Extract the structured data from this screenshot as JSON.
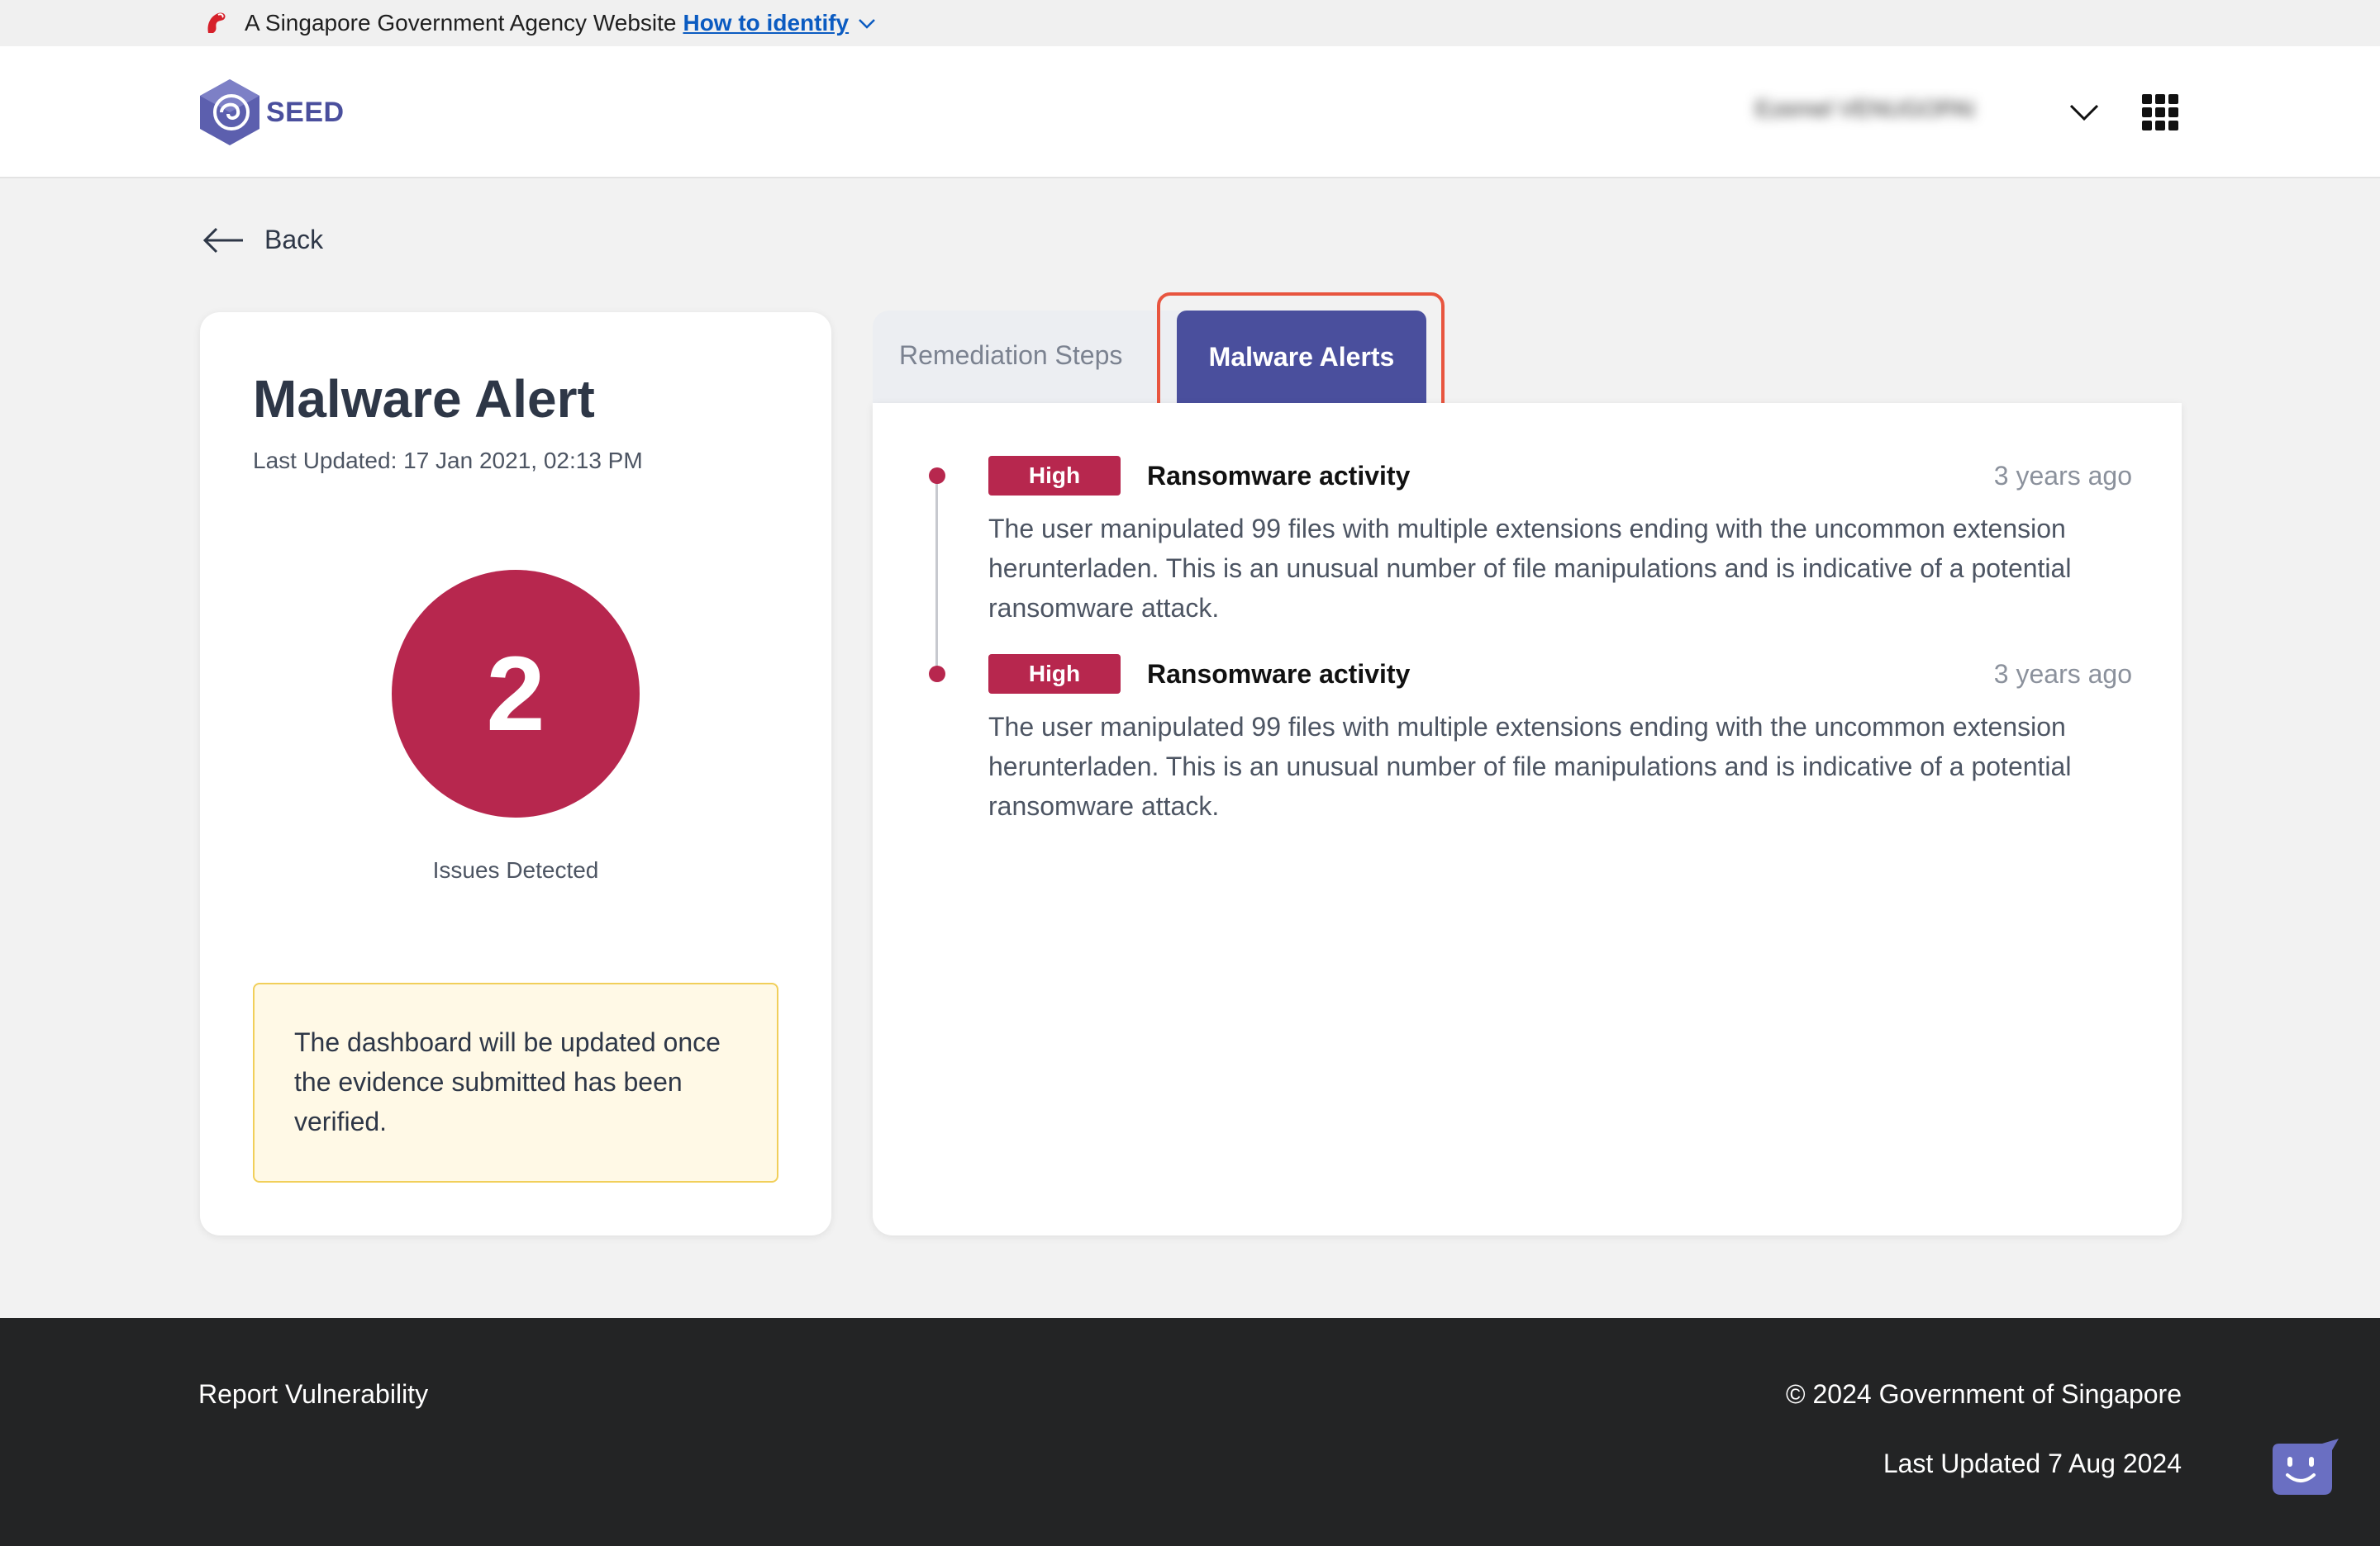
{
  "masthead": {
    "text": "A Singapore Government Agency Website",
    "link": "How to identify"
  },
  "header": {
    "logo_text": "SEED",
    "user_name": "Ezemel VENUGOPALAN",
    "icons": {
      "logo": "seed-logo-icon",
      "user_menu": "chevron-down-icon",
      "apps": "apps-grid-icon"
    }
  },
  "back": {
    "label": "Back"
  },
  "summary": {
    "title": "Malware Alert",
    "last_updated": "Last Updated: 17 Jan 2021, 02:13 PM",
    "issue_count": "2",
    "issue_label": "Issues Detected",
    "note": "The dashboard will be updated once the evidence submitted has been verified."
  },
  "tabs": {
    "remediation": "Remediation Steps",
    "malware": "Malware Alerts",
    "active": "malware"
  },
  "alerts": [
    {
      "severity": "High",
      "title": "Ransomware activity",
      "time": "3 years ago",
      "description": "The user manipulated 99 files with multiple extensions ending with the uncommon extension herunterladen. This is an unusual number of file manipulations and is indicative of a potential ransomware attack."
    },
    {
      "severity": "High",
      "title": "Ransomware activity",
      "time": "3 years ago",
      "description": "The user manipulated 99 files with multiple extensions ending with the uncommon extension herunterladen. This is an unusual number of file manipulations and is indicative of a potential ransomware attack."
    }
  ],
  "footer": {
    "report": "Report Vulnerability",
    "copyright": "© 2024 Government of Singapore",
    "last_updated": "Last Updated 7 Aug 2024"
  },
  "colors": {
    "brand": "#4a4f9d",
    "severity_high": "#b7274e",
    "highlight": "#e8553f",
    "note_bg": "#fff9e6",
    "note_border": "#f1cf5a"
  }
}
